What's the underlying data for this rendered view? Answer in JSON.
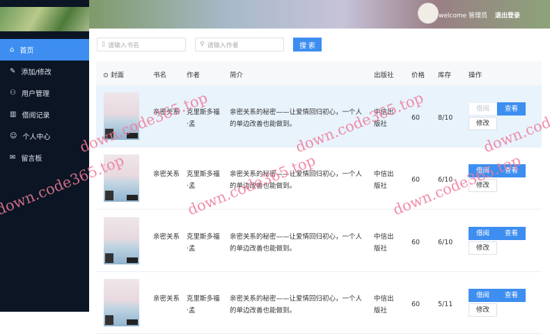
{
  "header": {
    "welcome": "welcome 管理员",
    "logout": "退出登录"
  },
  "sidebar": {
    "items": [
      {
        "label": "首页",
        "icon": "⌂"
      },
      {
        "label": "添加/修改",
        "icon": "✎"
      },
      {
        "label": "用户管理",
        "icon": "⚇"
      },
      {
        "label": "借阅记录",
        "icon": "▥"
      },
      {
        "label": "个人中心",
        "icon": "☺"
      },
      {
        "label": "留言板",
        "icon": "✉"
      }
    ]
  },
  "search": {
    "book_placeholder": "请输入书名",
    "author_placeholder": "请输入作者",
    "button": "搜 索"
  },
  "table": {
    "headers": {
      "cover": "封面",
      "name": "书名",
      "author": "作者",
      "intro": "简介",
      "publisher": "出版社",
      "price": "价格",
      "stock": "库存",
      "ops": "操作"
    },
    "rows": [
      {
        "name": "亲密关系",
        "author": "克里斯多福·孟",
        "intro": "亲密关系的秘密——让爱情回归初心，一个人的单边改善也能做到。",
        "publisher": "中信出版社",
        "price": "60",
        "stock": "8/10",
        "borrow": "借阅",
        "view": "查看",
        "edit": "修改",
        "borrow_disabled": true
      },
      {
        "name": "亲密关系",
        "author": "克里斯多福·孟",
        "intro": "亲密关系的秘密——让爱情回归初心，一个人的单边改善也能做到。",
        "publisher": "中信出版社",
        "price": "60",
        "stock": "6/10",
        "borrow": "借阅",
        "view": "查看",
        "edit": "修改",
        "borrow_disabled": false
      },
      {
        "name": "亲密关系",
        "author": "克里斯多福·孟",
        "intro": "亲密关系的秘密——让爱情回归初心，一个人的单边改善也能做到。",
        "publisher": "中信出版社",
        "price": "60",
        "stock": "6/10",
        "borrow": "借阅",
        "view": "查看",
        "edit": "修改",
        "borrow_disabled": false
      },
      {
        "name": "亲密关系",
        "author": "克里斯多福·孟",
        "intro": "亲密关系的秘密——让爱情回归初心，一个人的单边改善也能做到。",
        "publisher": "中信出版社",
        "price": "60",
        "stock": "5/11",
        "borrow": "借阅",
        "view": "查看",
        "edit": "修改",
        "borrow_disabled": false
      }
    ]
  },
  "watermark": "down.code365.top"
}
